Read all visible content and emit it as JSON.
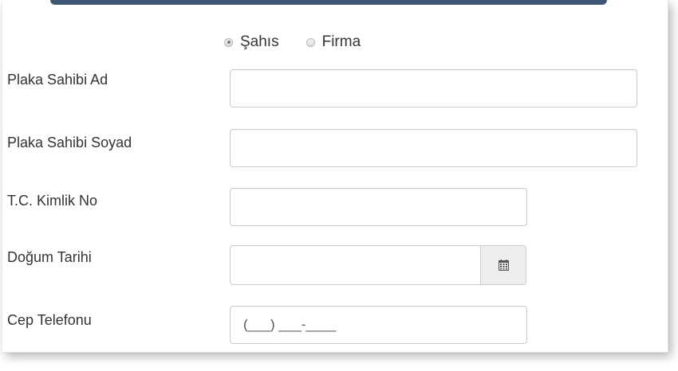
{
  "owner_type": {
    "options": [
      {
        "label": "Şahıs",
        "checked": true
      },
      {
        "label": "Firma",
        "checked": false
      }
    ]
  },
  "fields": {
    "first_name": {
      "label": "Plaka Sahibi Ad",
      "value": ""
    },
    "last_name": {
      "label": "Plaka Sahibi Soyad",
      "value": ""
    },
    "tc_id": {
      "label": "T.C. Kimlik No",
      "value": ""
    },
    "birth_date": {
      "label": "Doğum Tarihi",
      "value": "",
      "icon": "calendar-icon"
    },
    "mobile_phone": {
      "label": "Cep Telefonu",
      "placeholder": "(___) ___-____"
    }
  },
  "colors": {
    "header_accent": "#3f5775",
    "input_border": "#cccccc",
    "addon_background": "#eeeeee"
  }
}
